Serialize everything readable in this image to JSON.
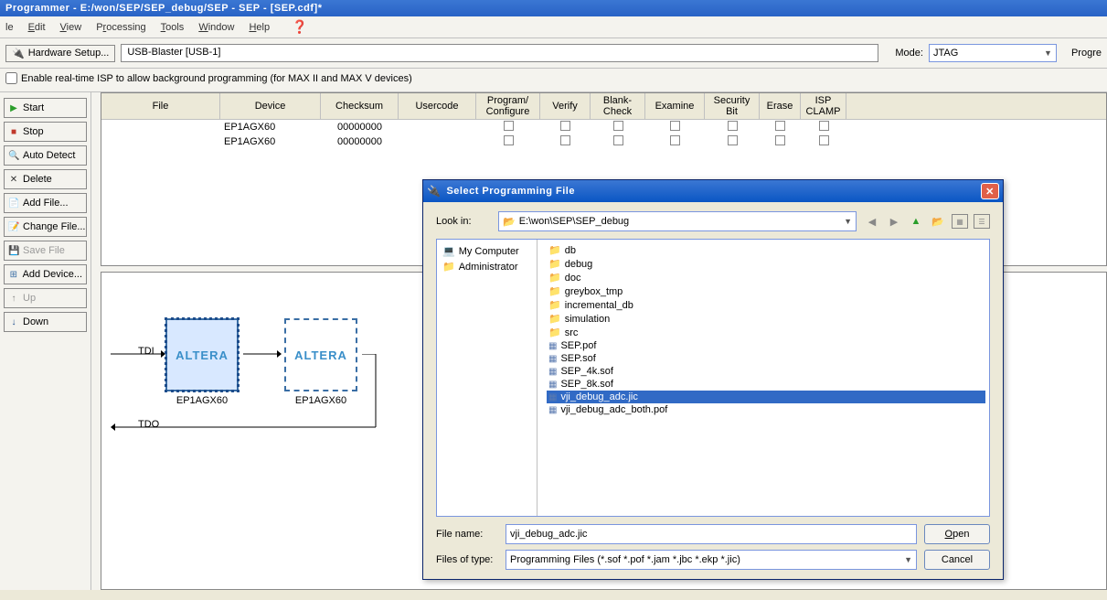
{
  "window": {
    "title": "Programmer - E:/won/SEP/SEP_debug/SEP - SEP - [SEP.cdf]*"
  },
  "menu": {
    "items": [
      "le",
      "Edit",
      "View",
      "Processing",
      "Tools",
      "Window",
      "Help"
    ],
    "underline_pos": [
      0,
      0,
      0,
      1,
      0,
      0,
      0
    ]
  },
  "toolbar": {
    "hw_setup": "Hardware Setup...",
    "hw_value": "USB-Blaster [USB-1]",
    "mode_label": "Mode:",
    "mode_value": "JTAG",
    "progress_label": "Progre"
  },
  "option_row": {
    "realtime_isp": "Enable real-time ISP to allow background programming (for MAX II and MAX V devices)"
  },
  "side_buttons": [
    {
      "label": "Start",
      "icon": "▶",
      "color": "#2a9d2a"
    },
    {
      "label": "Stop",
      "icon": "■",
      "color": "#c0392b"
    },
    {
      "label": "Auto Detect",
      "icon": "🔍",
      "color": "#3a6ea5"
    },
    {
      "label": "Delete",
      "icon": "✕",
      "color": "#333"
    },
    {
      "label": "Add File...",
      "icon": "📄",
      "color": "#e5b94a"
    },
    {
      "label": "Change File...",
      "icon": "📝",
      "color": "#e5b94a"
    },
    {
      "label": "Save File",
      "icon": "💾",
      "color": "#888",
      "disabled": true
    },
    {
      "label": "Add Device...",
      "icon": "⊞",
      "color": "#3a6ea5"
    },
    {
      "label": "Up",
      "icon": "↑",
      "color": "#888",
      "disabled": true
    },
    {
      "label": "Down",
      "icon": "↓",
      "color": "#1e4d8c"
    }
  ],
  "grid": {
    "headers": [
      "File",
      "Device",
      "Checksum",
      "Usercode",
      "Program/\nConfigure",
      "Verify",
      "Blank-\nCheck",
      "Examine",
      "Security\nBit",
      "Erase",
      "ISP\nCLAMP"
    ],
    "rows": [
      {
        "file": "<none>",
        "device": "EP1AGX60",
        "checksum": "00000000",
        "usercode": "<none>"
      },
      {
        "file": "<none>",
        "device": "EP1AGX60",
        "checksum": "00000000",
        "usercode": ""
      }
    ]
  },
  "chain": {
    "tdi": "TDI",
    "tdo": "TDO",
    "chip_label": "ALTERA",
    "chip1_name": "EP1AGX60",
    "chip2_name": "EP1AGX60"
  },
  "dialog": {
    "title": "Select Programming File",
    "lookin_label": "Look in:",
    "lookin_value": "E:\\won\\SEP\\SEP_debug",
    "places": [
      {
        "label": "My Computer",
        "icon": "💻"
      },
      {
        "label": "Administrator",
        "icon": "📁"
      }
    ],
    "files": [
      {
        "name": "db",
        "type": "folder"
      },
      {
        "name": "debug",
        "type": "folder"
      },
      {
        "name": "doc",
        "type": "folder"
      },
      {
        "name": "greybox_tmp",
        "type": "folder"
      },
      {
        "name": "incremental_db",
        "type": "folder"
      },
      {
        "name": "simulation",
        "type": "folder"
      },
      {
        "name": "src",
        "type": "folder"
      },
      {
        "name": "SEP.pof",
        "type": "file"
      },
      {
        "name": "SEP.sof",
        "type": "file"
      },
      {
        "name": "SEP_4k.sof",
        "type": "file"
      },
      {
        "name": "SEP_8k.sof",
        "type": "file"
      },
      {
        "name": "vji_debug_adc.jic",
        "type": "file",
        "selected": true
      },
      {
        "name": "vji_debug_adc_both.pof",
        "type": "file"
      }
    ],
    "filename_label": "File name:",
    "filename_value": "vji_debug_adc.jic",
    "filetype_label": "Files of type:",
    "filetype_value": "Programming Files (*.sof *.pof *.jam *.jbc *.ekp *.jic)",
    "open_btn": "Open",
    "cancel_btn": "Cancel"
  }
}
